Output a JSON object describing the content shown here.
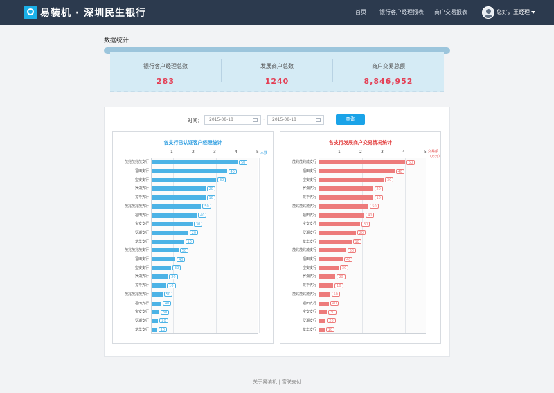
{
  "header": {
    "brand": "易装机 · 深圳民生银行",
    "nav": [
      "首页",
      "银行客户经理报表",
      "商户交易报表"
    ],
    "user": "您好，王经理"
  },
  "section_title": "数据统计",
  "stats": [
    {
      "label": "银行客户经理总数",
      "value": "283"
    },
    {
      "label": "发展商户总数",
      "value": "1240"
    },
    {
      "label": "商户交易总额",
      "value": "8,846,952"
    }
  ],
  "filter": {
    "label": "时间：",
    "start_date": "2015-08-18",
    "end_date": "2015-08-18",
    "separator": "-",
    "button": "查询"
  },
  "footer": "关于易装机  |  富联支付",
  "colors": {
    "blue_bar": "#4cb3e6",
    "red_bar": "#ed7b7b",
    "title_blue": "#2d9de0",
    "title_red": "#e23e3e"
  },
  "chart_data": [
    {
      "type": "bar",
      "orientation": "horizontal",
      "title": "各支行已认证客户经理统计",
      "unit": "人数",
      "x_ticks": [
        "1",
        "2",
        "3",
        "4",
        "5"
      ],
      "xlim": [
        0,
        5
      ],
      "color": "#4cb3e6",
      "title_color": "#2d9de0",
      "categories": [
        "茂兆茂兆茂支行",
        "福田支行",
        "宝安支行",
        "罗湖支行",
        "龙华支行",
        "茂兆茂兆茂支行",
        "福田支行",
        "宝安支行",
        "罗湖支行",
        "龙华支行",
        "茂兆茂兆茂支行",
        "福田支行",
        "宝安支行",
        "罗湖支行",
        "龙华支行",
        "茂兆茂兆茂支行",
        "福田支行",
        "宝安支行",
        "罗湖支行",
        "龙华支行"
      ],
      "values": [
        4.0,
        3.5,
        3.0,
        2.5,
        2.5,
        2.3,
        2.1,
        1.9,
        1.7,
        1.5,
        1.25,
        1.1,
        0.9,
        0.75,
        0.65,
        0.5,
        0.45,
        0.35,
        0.3,
        0.25
      ],
      "data_labels": [
        "50",
        "40",
        "30",
        "20",
        "10",
        "50",
        "40",
        "30",
        "20",
        "10",
        "50",
        "40",
        "30",
        "20",
        "10",
        "50",
        "40",
        "30",
        "20",
        "10"
      ]
    },
    {
      "type": "bar",
      "orientation": "horizontal",
      "title": "各支行发展商户交易情况统计",
      "unit": "交易额（万元）",
      "x_ticks": [
        "1",
        "2",
        "3",
        "4",
        "5"
      ],
      "xlim": [
        0,
        5
      ],
      "color": "#ed7b7b",
      "title_color": "#e23e3e",
      "categories": [
        "茂兆茂兆茂支行",
        "福田支行",
        "宝安支行",
        "罗湖支行",
        "龙华支行",
        "茂兆茂兆茂支行",
        "福田支行",
        "宝安支行",
        "罗湖支行",
        "龙华支行",
        "茂兆茂兆茂支行",
        "福田支行",
        "宝安支行",
        "罗湖支行",
        "龙华支行",
        "茂兆茂兆茂支行",
        "福田支行",
        "宝安支行",
        "罗湖支行",
        "龙华支行"
      ],
      "values": [
        4.0,
        3.5,
        3.0,
        2.5,
        2.5,
        2.3,
        2.1,
        1.9,
        1.7,
        1.5,
        1.25,
        1.1,
        0.9,
        0.75,
        0.65,
        0.5,
        0.45,
        0.35,
        0.3,
        0.25
      ],
      "data_labels": [
        "50",
        "40",
        "30",
        "20",
        "10",
        "50",
        "40",
        "30",
        "20",
        "10",
        "50",
        "40",
        "30",
        "20",
        "10",
        "50",
        "40",
        "30",
        "20",
        "10"
      ]
    }
  ]
}
